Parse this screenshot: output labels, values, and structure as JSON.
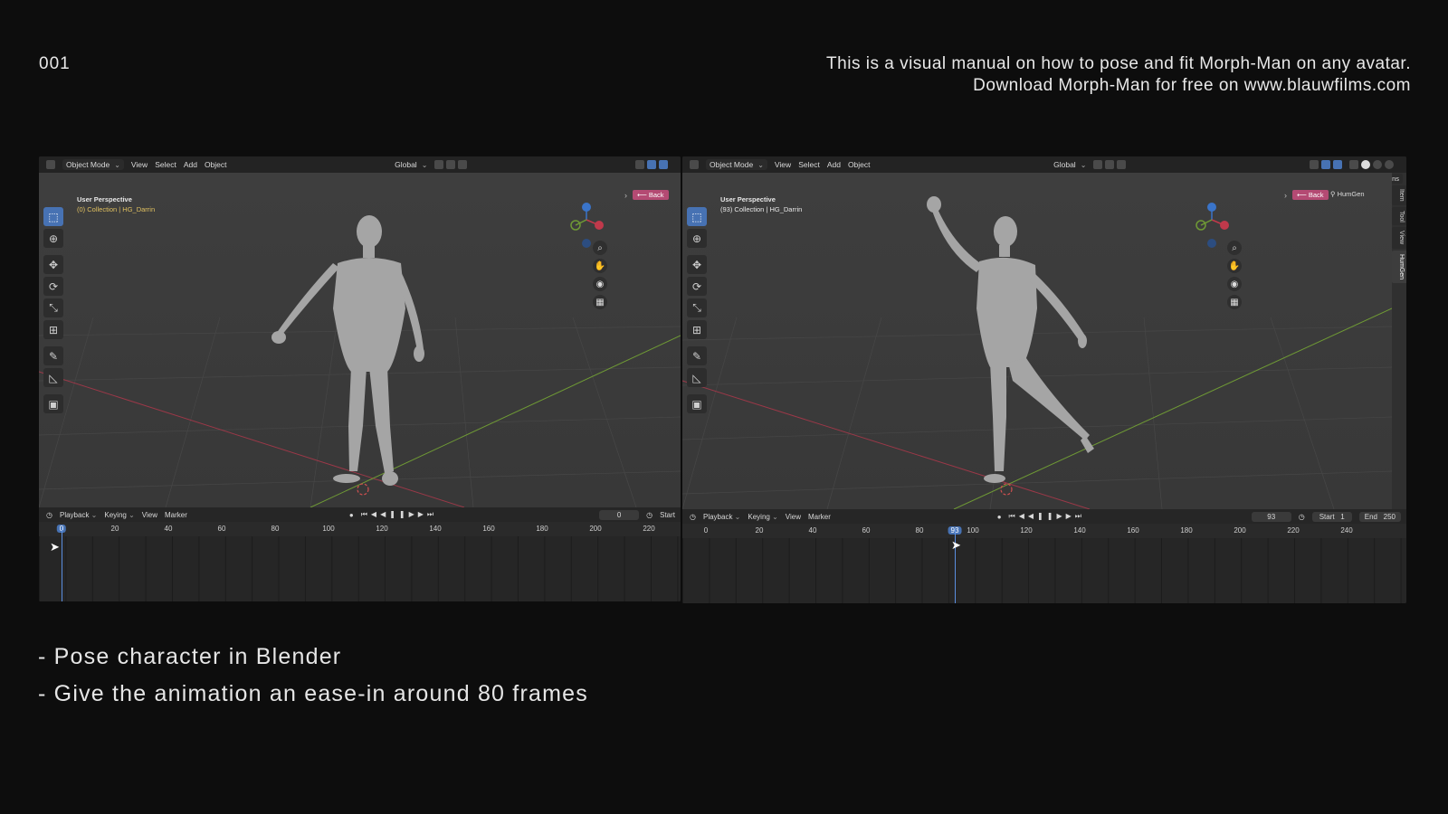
{
  "slide": {
    "number": "001",
    "intro_line1": "This is a visual manual on how to pose and fit Morph-Man on any avatar.",
    "intro_line2": "Download Morph-Man for free on www.blauwfilms.com",
    "bullet1": "- Pose character in Blender",
    "bullet2": "- Give the animation an ease-in around 80 frames"
  },
  "left_panel": {
    "header": {
      "mode": "Object Mode",
      "menu": [
        "View",
        "Select",
        "Add",
        "Object"
      ],
      "orientation": "Global"
    },
    "viewport": {
      "perspective": "User Perspective",
      "collection": "(0) Collection | HG_Darrin",
      "back_label": "Back"
    },
    "timeline": {
      "menu": [
        "Playback",
        "Keying",
        "View",
        "Marker"
      ],
      "current_frame": "0",
      "start_label": "Start",
      "ruler": [
        "0",
        "20",
        "40",
        "60",
        "80",
        "100",
        "120",
        "140",
        "160",
        "180",
        "200",
        "220"
      ]
    }
  },
  "right_panel": {
    "header": {
      "mode": "Object Mode",
      "menu": [
        "View",
        "Select",
        "Add",
        "Object"
      ],
      "orientation": "Global",
      "options_label": "Options"
    },
    "viewport": {
      "perspective": "User Perspective",
      "collection": "(93) Collection | HG_Darrin",
      "back_label": "Back",
      "humgen_label": "HumGen",
      "side_tabs": [
        "Item",
        "Tool",
        "View",
        "HumGen"
      ]
    },
    "timeline": {
      "menu": [
        "Playback",
        "Keying",
        "View",
        "Marker"
      ],
      "current_frame": "93",
      "start_label": "Start",
      "start_value": "1",
      "end_label": "End",
      "end_value": "250",
      "ruler": [
        "0",
        "20",
        "40",
        "60",
        "80",
        "93",
        "100",
        "120",
        "140",
        "160",
        "180",
        "200",
        "220",
        "240"
      ]
    }
  },
  "colors": {
    "accent_blue": "#4772b3",
    "back_pink": "#b44a73",
    "axis_red": "#c0394b",
    "axis_green": "#6f9a35",
    "axis_blue": "#3a74c9"
  },
  "icons": [
    "select-box-icon",
    "cursor-icon",
    "move-icon",
    "rotate-icon",
    "scale-icon",
    "transform-icon",
    "annotate-icon",
    "measure-icon",
    "add-cube-icon",
    "zoom-icon",
    "hand-pan-icon",
    "camera-icon",
    "grid-icon"
  ]
}
